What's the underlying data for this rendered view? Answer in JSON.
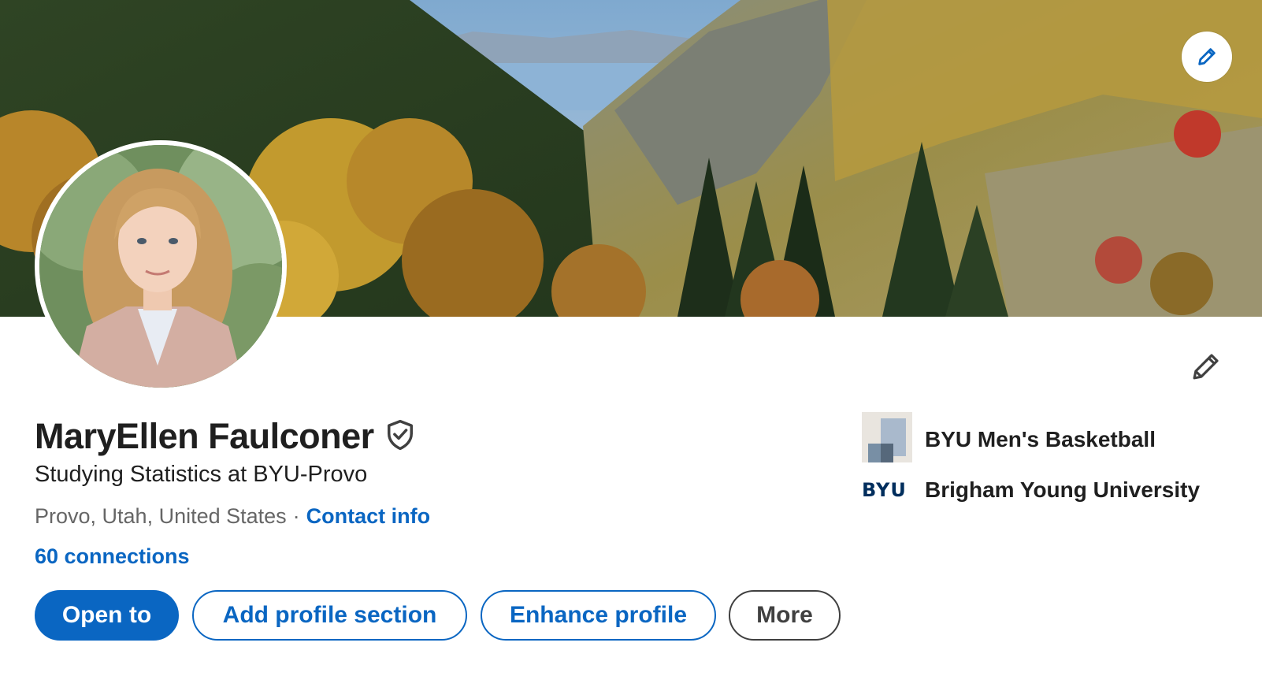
{
  "profile": {
    "name": "MaryEllen Faulconer",
    "headline": "Studying Statistics at BYU-Provo",
    "location": "Provo, Utah, United States",
    "separator": "·",
    "contact_info": "Contact info",
    "connections": "60 connections"
  },
  "actions": {
    "open_to": "Open to",
    "add_profile_section": "Add profile section",
    "enhance_profile": "Enhance profile",
    "more": "More"
  },
  "organizations": [
    {
      "label": "BYU Men's Basketball",
      "icon": "company-placeholder-logo"
    },
    {
      "label": "Brigham Young University",
      "icon": "byu-logo",
      "logo_text": "BYU"
    }
  ],
  "icons": {
    "cover_edit": "pencil-icon",
    "intro_edit": "pencil-icon",
    "verified": "shield-check-icon"
  },
  "colors": {
    "primary": "#0a66c2",
    "text": "#1f1f1f",
    "muted": "#666666",
    "byu_blue": "#002e5d"
  }
}
